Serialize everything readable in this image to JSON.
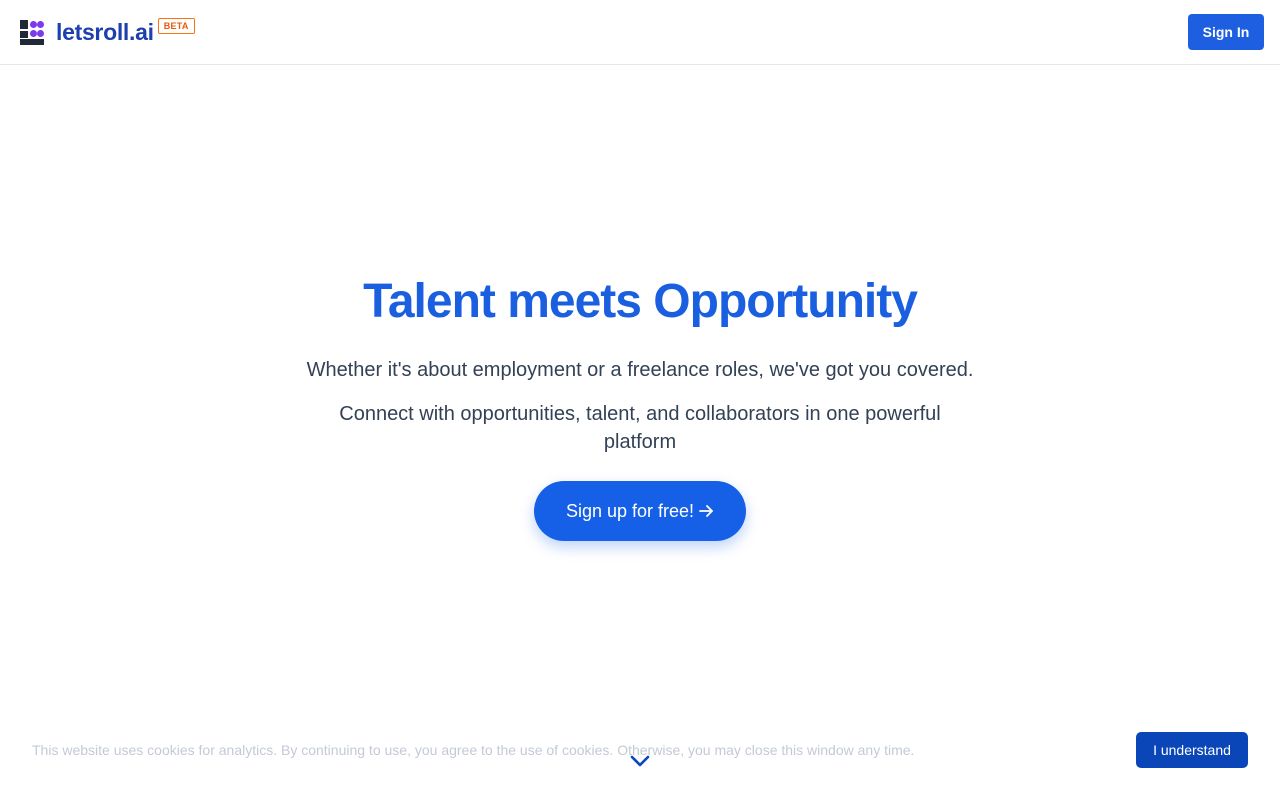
{
  "header": {
    "brand": "letsroll.ai",
    "badge": "BETA",
    "signin_label": "Sign In"
  },
  "hero": {
    "title": "Talent meets Opportunity",
    "subtitle1": "Whether it's about employment or a freelance roles, we've got you covered.",
    "subtitle2": "Connect with opportunities, talent, and collaborators in one powerful platform",
    "cta_label": "Sign up for free!",
    "cta_icon": "arrow-right-icon"
  },
  "cookie": {
    "text": "This website uses cookies for analytics. By continuing to use, you agree to the use of cookies. Otherwise, you may close this window any time.",
    "button_label": "I understand"
  },
  "scroll": {
    "icon": "chevron-down-icon"
  },
  "colors": {
    "primary": "#1560e6",
    "brand": "#1e40af",
    "badge": "#ea580c",
    "logo_dots": "#7c3aed"
  }
}
